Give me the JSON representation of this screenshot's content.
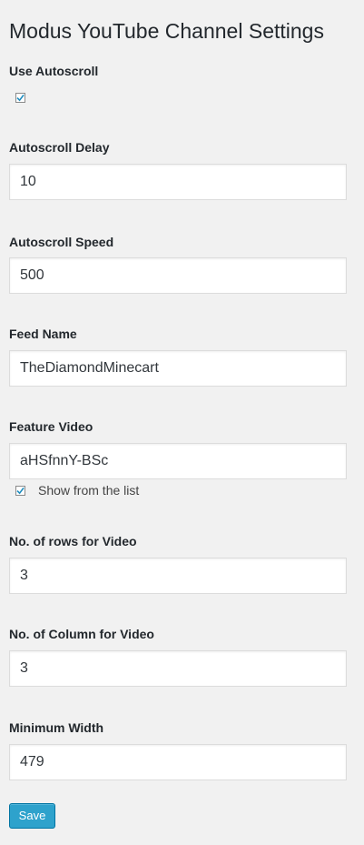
{
  "page": {
    "title": "Modus YouTube Channel Settings"
  },
  "autoscroll": {
    "label": "Use Autoscroll",
    "checked": true
  },
  "fields": {
    "autoscroll_delay": {
      "label": "Autoscroll Delay",
      "value": "10"
    },
    "autoscroll_speed": {
      "label": "Autoscroll Speed",
      "value": "500"
    },
    "feed_name": {
      "label": "Feed Name",
      "value": "TheDiamondMinecart"
    },
    "feature_video": {
      "label": "Feature Video",
      "value": "aHSfnnY-BSc"
    },
    "rows_for_video": {
      "label": "No. of rows for Video",
      "value": "3"
    },
    "columns_for_video": {
      "label": "No. of Column for Video",
      "value": "3"
    },
    "minimum_width": {
      "label": "Minimum Width",
      "value": "479"
    }
  },
  "show_from_list": {
    "label": "Show from the list",
    "checked": true
  },
  "save_button": {
    "label": "Save"
  },
  "colors": {
    "background": "#f1f1f1",
    "primary_button": "#2ea2cc",
    "checkmark": "#1e8cbe"
  }
}
